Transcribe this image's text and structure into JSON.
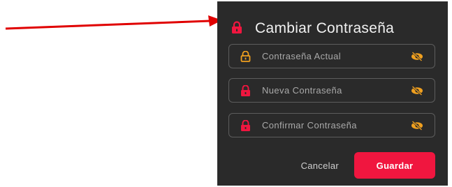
{
  "dialog": {
    "title": "Cambiar Contraseña",
    "fields": [
      {
        "placeholder": "Contraseña Actual",
        "lock_icon": "lock-open-outline-icon",
        "visibility_icon": "eye-off-icon"
      },
      {
        "placeholder": "Nueva Contraseña",
        "lock_icon": "lock-icon",
        "visibility_icon": "eye-off-icon"
      },
      {
        "placeholder": "Confirmar Contraseña",
        "lock_icon": "lock-icon",
        "visibility_icon": "eye-off-icon"
      }
    ],
    "cancel_label": "Cancelar",
    "save_label": "Guardar"
  },
  "colors": {
    "dialog_background": "#2a2a2a",
    "accent_red": "#f0163f",
    "orange_icon": "#f0a01f",
    "annotation_arrow": "#e00000"
  }
}
